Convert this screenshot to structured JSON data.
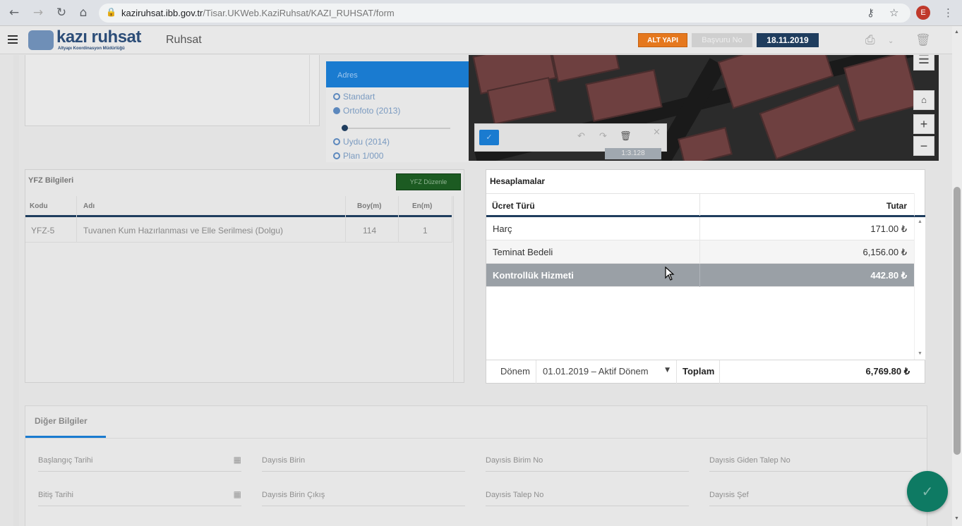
{
  "browser": {
    "url_host": "kaziruhsat.ibb.gov.tr",
    "url_path": "/Tisar.UKWeb.KaziRuhsat/KAZI_RUHSAT/form",
    "avatar_letter": "E"
  },
  "header": {
    "logo_word": "kazı ruhsat",
    "logo_sub": "Altyapı Koordinasyon Müdürlüğü",
    "module_title": "Ruhsat",
    "badge_orange": "ALT YAPI",
    "badge_grey": "Başvuru No",
    "date": "18.11.2019"
  },
  "layers": {
    "head": "Adres",
    "options": [
      "Standart",
      "Ortofoto (2013)",
      "Uydu (2014)",
      "Plan 1/000"
    ]
  },
  "map": {
    "scale": "1:3.128",
    "zoom_in": "+",
    "zoom_out": "−"
  },
  "yfz": {
    "title": "YFZ Bilgileri",
    "button": "YFZ Düzenle",
    "columns": [
      "Kodu",
      "Adı",
      "Boy(m)",
      "En(m)"
    ],
    "rows": [
      {
        "kodu": "YFZ-5",
        "adi": "Tuvanen Kum Hazırlanması ve Elle Serilmesi (Dolgu)",
        "boy": "114",
        "en": "1"
      }
    ]
  },
  "hesaplamalar": {
    "title": "Hesaplamalar",
    "col_type": "Ücret Türü",
    "col_amount": "Tutar",
    "rows": [
      {
        "type": "Harç",
        "amount": "171.00 ₺"
      },
      {
        "type": "Teminat Bedeli",
        "amount": "6,156.00 ₺"
      },
      {
        "type": "Kontrollük Hizmeti",
        "amount": "442.80 ₺"
      }
    ],
    "period_label": "Dönem",
    "period_value": "01.01.2019 – Aktif Dönem",
    "total_label": "Toplam",
    "total_value": "6,769.80 ₺"
  },
  "diger": {
    "tab": "Diğer Bilgiler",
    "fields": [
      "Başlangıç Tarihi",
      "Dayısis Birin",
      "Dayısis Birim No",
      "Dayısis Giden Talep No",
      "Bitiş Tarihi",
      "Dayısis Birin Çıkış",
      "Dayısis Talep No",
      "Dayısis Şef"
    ]
  }
}
